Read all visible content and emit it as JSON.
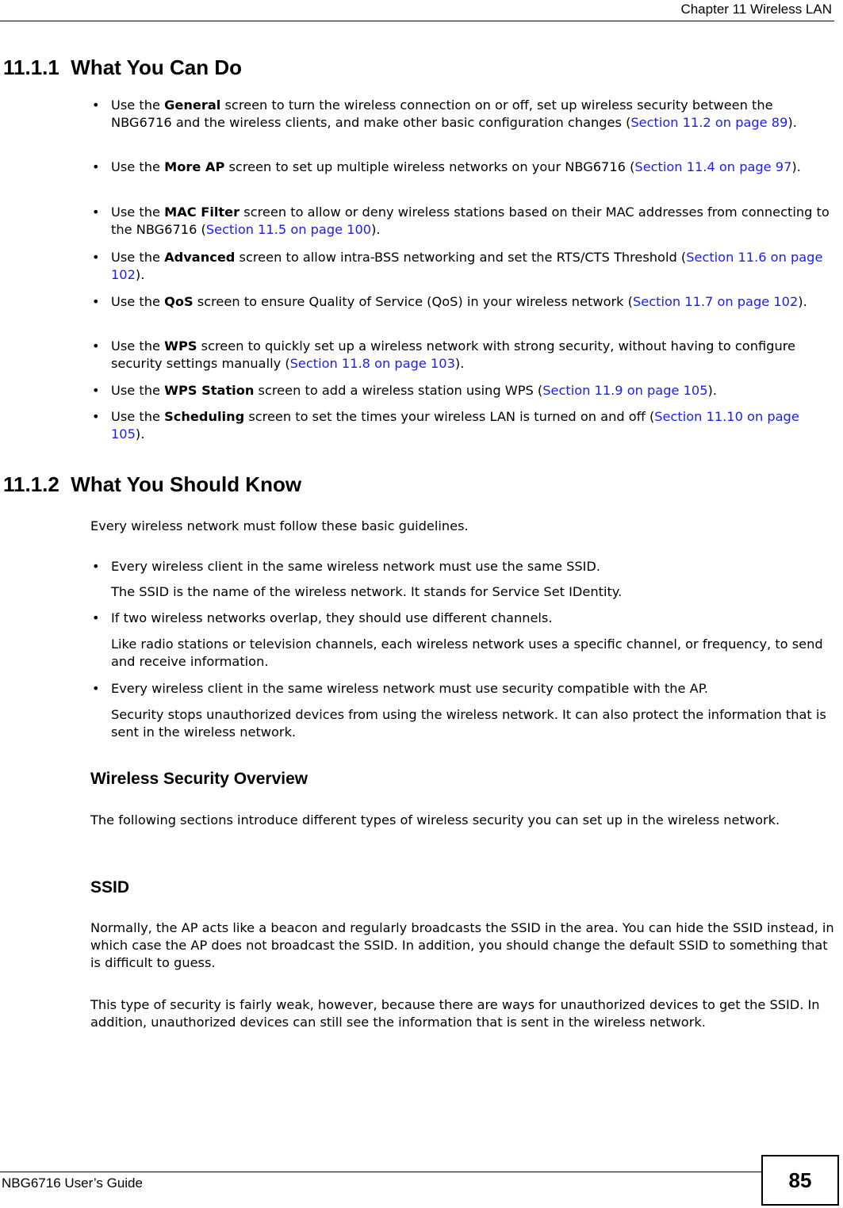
{
  "header": {
    "chapter_title": "Chapter 11 Wireless LAN"
  },
  "section1": {
    "heading": "11.1.1  What You Can Do",
    "bullets": [
      {
        "pre": "Use the ",
        "bold": "General",
        "mid": " screen to turn the wireless connection on or off, set up wireless security between the NBG6716 and the wireless clients, and make other basic configuration changes (",
        "link": "Section 11.2 on page 89",
        "post": ")."
      },
      {
        "pre": "Use the ",
        "bold": "More AP",
        "mid": " screen to set up multiple wireless networks on your NBG6716 (",
        "link": "Section 11.4 on page 97",
        "post": ")."
      },
      {
        "pre": "Use the ",
        "bold": "MAC Filter",
        "mid": " screen to allow or deny wireless stations based on their MAC addresses from connecting to the NBG6716 (",
        "link": "Section 11.5 on page 100",
        "post": ")."
      },
      {
        "pre": "Use the ",
        "bold": "Advanced",
        "mid": " screen to allow intra-BSS networking and set the RTS/CTS Threshold (",
        "link": "Section 11.6 on page 102",
        "post": ")."
      },
      {
        "pre": "Use the ",
        "bold": "QoS",
        "mid": " screen to ensure Quality of Service (QoS) in your wireless network (",
        "link": "Section 11.7 on page 102",
        "post": ")."
      },
      {
        "pre": "Use the ",
        "bold": "WPS",
        "mid": " screen to quickly set up a wireless network with strong security, without having to configure security settings manually (",
        "link": "Section 11.8 on page 103",
        "post": ")."
      },
      {
        "pre": "Use the ",
        "bold": "WPS Station",
        "mid": " screen to add a wireless station using WPS (",
        "link": "Section 11.9 on page 105",
        "post": ")."
      },
      {
        "pre": "Use the ",
        "bold": "Scheduling",
        "mid": " screen to set the times your wireless LAN is turned on and off (",
        "link": "Section 11.10 on page 105",
        "post": ")."
      }
    ]
  },
  "section2": {
    "heading": "11.1.2  What You Should Know",
    "intro": "Every wireless network must follow these basic guidelines.",
    "guidelines": [
      {
        "bullet": "Every wireless client in the same wireless network must use the same SSID.",
        "detail": "The SSID is the name of the wireless network. It stands for Service Set IDentity."
      },
      {
        "bullet": "If two wireless networks overlap, they should use different channels.",
        "detail": "Like radio stations or television channels, each wireless network uses a specific channel, or frequency, to send and receive information."
      },
      {
        "bullet": "Every wireless client in the same wireless network must use security compatible with the AP.",
        "detail": "Security stops unauthorized devices from using the wireless network. It can also protect the information that is sent in the wireless network."
      }
    ]
  },
  "security_overview": {
    "heading": "Wireless Security Overview",
    "text": "The following sections introduce different types of wireless security you can set up in the wireless network."
  },
  "ssid": {
    "heading": "SSID",
    "paragraphs": [
      "Normally, the AP acts like a beacon and regularly broadcasts the SSID in the area. You can hide the SSID instead, in which case the AP does not broadcast the SSID. In addition, you should change the default SSID to something that is difficult to guess.",
      "This type of security is fairly weak, however, because there are ways for unauthorized devices to get the SSID. In addition, unauthorized devices can still see the information that is sent in the wireless network."
    ]
  },
  "footer": {
    "guide_title": "NBG6716 User’s Guide",
    "page_number": "85"
  },
  "bullet_glyph": "•",
  "colors": {
    "link": "#1a1aff"
  }
}
